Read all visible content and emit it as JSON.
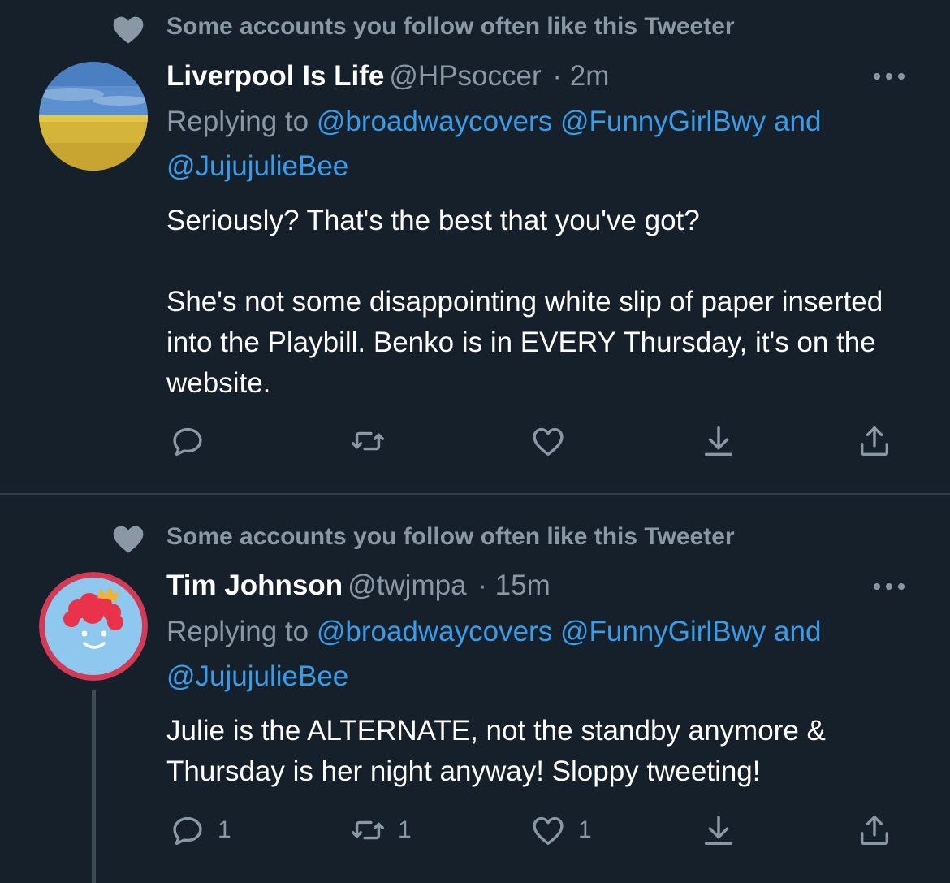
{
  "colors": {
    "background": "#16202b",
    "secondary_text": "#8a98a5",
    "link": "#3a9ce8",
    "divider": "#2f3b47"
  },
  "tweets": [
    {
      "social_context": "Some accounts you follow often like this Tweeter",
      "social_icon": "heart-filled-icon",
      "name": "Liverpool Is Life",
      "handle": "@HPsoccer",
      "time": "· 2m",
      "reply_prefix": "Replying to",
      "reply_to": [
        "@broadwaycovers",
        "@FunnyGirlBwy",
        "and",
        "@JujujulieBee"
      ],
      "text": "Seriously?  That's the best that you've got?\n\nShe's not some disappointing white slip of paper inserted into the Playbill.  Benko is in EVERY Thursday, it's on the website.",
      "counts": {
        "reply": "",
        "retweet": "",
        "like": ""
      }
    },
    {
      "social_context": "Some accounts you follow often like this Tweeter",
      "social_icon": "heart-filled-icon",
      "name": "Tim Johnson",
      "handle": "@twjmpa",
      "time": "· 15m",
      "reply_prefix": "Replying to",
      "reply_to": [
        "@broadwaycovers",
        "@FunnyGirlBwy",
        "and",
        "@JujujulieBee"
      ],
      "text": "Julie is the ALTERNATE, not the standby anymore & Thursday is her night anyway!  Sloppy tweeting!",
      "counts": {
        "reply": "1",
        "retweet": "1",
        "like": "1"
      }
    }
  ]
}
